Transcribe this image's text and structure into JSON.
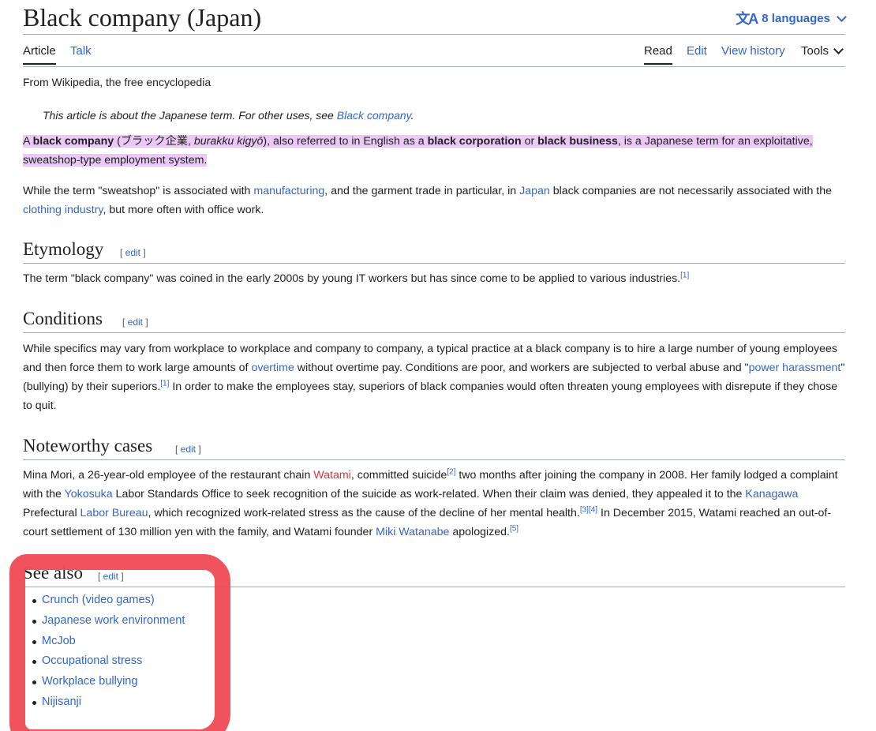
{
  "header": {
    "title": "Black company (Japan)",
    "languages_label": "8 languages"
  },
  "tabs": {
    "article": "Article",
    "talk": "Talk",
    "read": "Read",
    "edit": "Edit",
    "view_history": "View history",
    "tools": "Tools"
  },
  "tagline": "From Wikipedia, the free encyclopedia",
  "hatnote": {
    "text": "This article is about the Japanese term. For other uses, see ",
    "link": "Black company",
    "end": "."
  },
  "lead": {
    "p1": {
      "a": "A ",
      "b1": "black company",
      "c": " (",
      "jp": "ブラック企業",
      "d": ", ",
      "romaji": "burakku kigyō",
      "e": "), also referred to in English as a ",
      "b2": "black corporation",
      "f": " or ",
      "b3": "black business",
      "g": ", is a Japanese term for an exploitative, sweatshop-type employment system."
    },
    "p2": {
      "a": "While the term \"sweatshop\" is associated with ",
      "l1": "manufacturing",
      "b": ", and the garment trade in particular, in ",
      "l2": "Japan",
      "c": " black companies are not necessarily associated with the ",
      "l3": "clothing industry",
      "d": ", but more often with office work."
    }
  },
  "edit_link_label": "edit",
  "sections": {
    "etymology": {
      "heading": "Etymology",
      "text": "The term \"black company\" was coined in the early 2000s by young IT workers but has since come to be applied to various industries.",
      "ref": "[1]"
    },
    "conditions": {
      "heading": "Conditions",
      "a": "While specifics may vary from workplace to workplace and company to company, a typical practice at a black company is to hire a large number of young employees and then force them to work large amounts of ",
      "l1": "overtime",
      "b": " without overtime pay. Conditions are poor, and workers are subjected to verbal abuse and \"",
      "l2": "power harassment",
      "c": "\" (bullying) by their superiors.",
      "ref": "[1]",
      "d": " In order to make the employees stay, superiors of black companies would often threaten young employees with disrepute if they chose to quit."
    },
    "cases": {
      "heading": "Noteworthy cases",
      "a": "Mina Mori, a 26-year-old employee of the restaurant chain ",
      "l_watami": "Watami",
      "b": ", committed suicide",
      "ref2": "[2]",
      "c": " two months after joining the company in 2008. Her family lodged a complaint with the ",
      "l_yokosuka": "Yokosuka",
      "d": " Labor Standards Office to seek recognition of the suicide as work-related. When their claim was denied, they appealed it to the ",
      "l_kanagawa": "Kanagawa",
      "e": " Prefectural ",
      "l_labor": "Labor Bureau",
      "f": ", which recognized work-related stress as the cause of the decline of her mental health.",
      "ref34": "[3][4]",
      "g": " In December 2015, Watami reached an out-of-court settlement of 130 million yen with the family, and Watami founder ",
      "l_miki": "Miki Watanabe",
      "h": " apologized.",
      "ref5": "[5]"
    },
    "see_also": {
      "heading": "See also",
      "items": [
        "Crunch (video games)",
        "Japanese work environment",
        "McJob",
        "Occupational stress",
        "Workplace bullying",
        "Nijisanji"
      ]
    }
  },
  "colors": {
    "link": "#3366cc",
    "redlink": "#d33",
    "highlight": "#ecc8f7",
    "marker": "#ef4b57"
  }
}
